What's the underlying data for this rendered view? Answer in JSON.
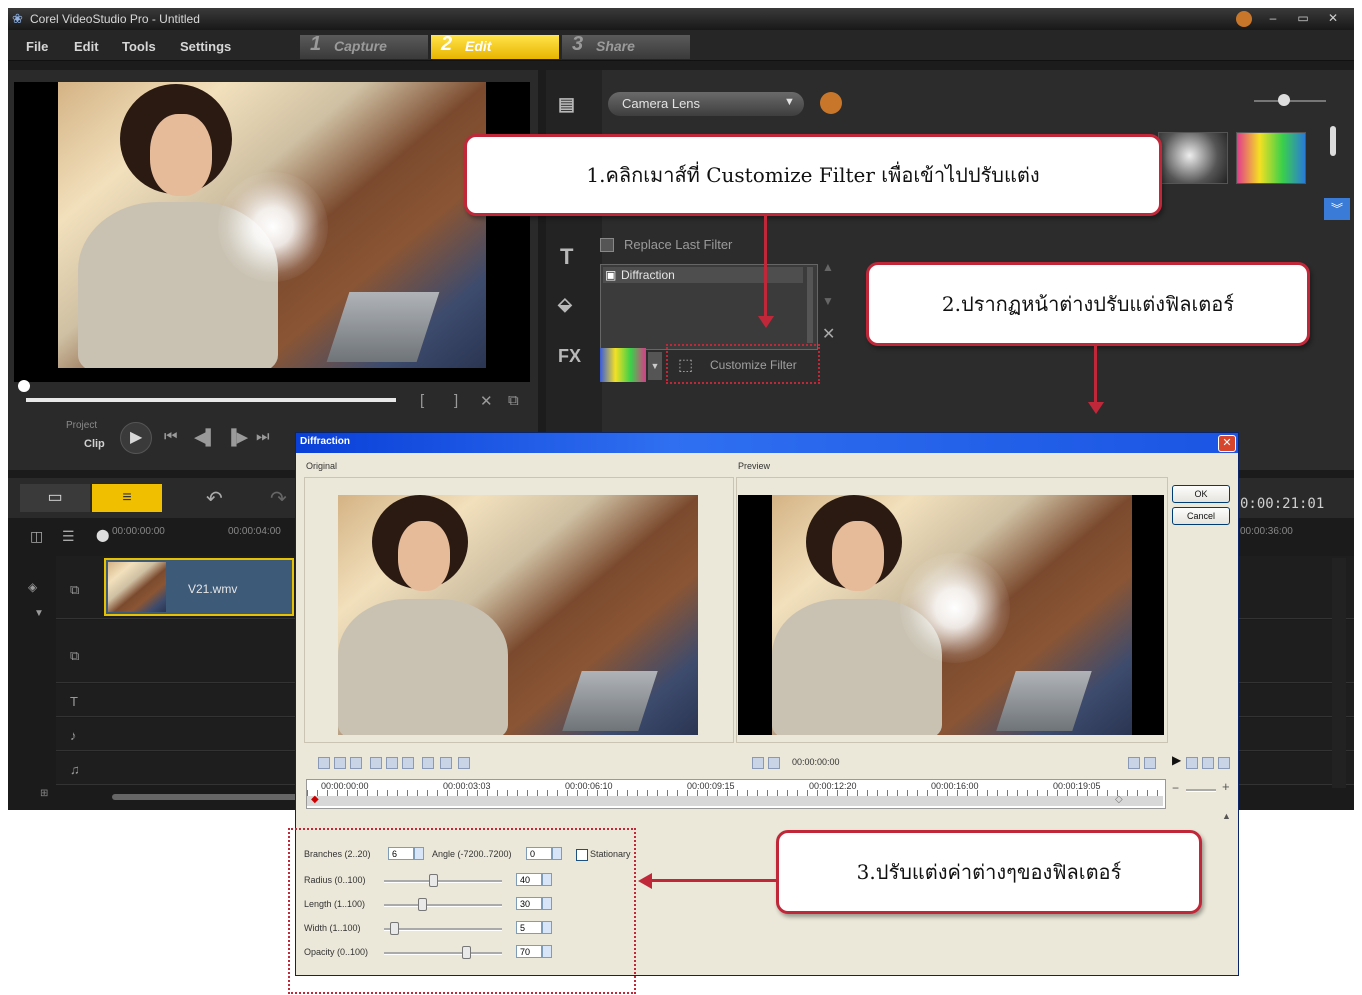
{
  "app": {
    "title": "Corel VideoStudio Pro - Untitled",
    "menu": [
      "File",
      "Edit",
      "Tools",
      "Settings"
    ],
    "steps": [
      {
        "num": "1",
        "label": "Capture"
      },
      {
        "num": "2",
        "label": "Edit"
      },
      {
        "num": "3",
        "label": "Share"
      }
    ],
    "window_controls": [
      "–",
      "▭",
      "✕"
    ]
  },
  "player": {
    "project_label": "Project",
    "clip_label": "Clip"
  },
  "library": {
    "dropdown_value": "Camera Lens",
    "replace_last_filter": "Replace Last Filter",
    "applied_filters": [
      "Diffraction"
    ],
    "customize_filter": "Customize Filter",
    "fx_label": "FX"
  },
  "timeline": {
    "ruler": [
      "00:00:00:00",
      "00:00:04:00"
    ],
    "clip_name": "V21.wmv",
    "timecode": "0:00:21:01",
    "ruler_right": "00:00:36:00"
  },
  "dialog": {
    "title": "Diffraction",
    "original_label": "Original",
    "preview_label": "Preview",
    "ok": "OK",
    "cancel": "Cancel",
    "preview_time": "00:00:00:00",
    "ruler": [
      "00:00:00:00",
      "00:00:03:03",
      "00:00:06:10",
      "00:00:09:15",
      "00:00:12:20",
      "00:00:16:00",
      "00:00:19:05"
    ],
    "params": [
      {
        "label": "Branches (2..20)",
        "value": "6",
        "slider": null
      },
      {
        "label": "Radius (0..100)",
        "value": "40",
        "slider": 0.4
      },
      {
        "label": "Length (1..100)",
        "value": "30",
        "slider": 0.3
      },
      {
        "label": "Width (1..100)",
        "value": "5",
        "slider": 0.05
      },
      {
        "label": "Opacity (0..100)",
        "value": "70",
        "slider": 0.7
      }
    ],
    "angle_label": "Angle (-7200..7200)",
    "angle_value": "0",
    "stationary_label": "Stationary"
  },
  "callouts": {
    "c1": "1.คลิกเมาส์ที่ Customize Filter เพื่อเข้าไปปรับแต่ง",
    "c2": "2.ปรากฏหน้าต่างปรับแต่งฟิลเตอร์",
    "c3": "3.ปรับแต่งค่าต่างๆของฟิลเตอร์"
  },
  "colors": {
    "accent": "#f0c000",
    "callout_border": "#c0283a",
    "dialog_title": "#0a3fd8"
  }
}
